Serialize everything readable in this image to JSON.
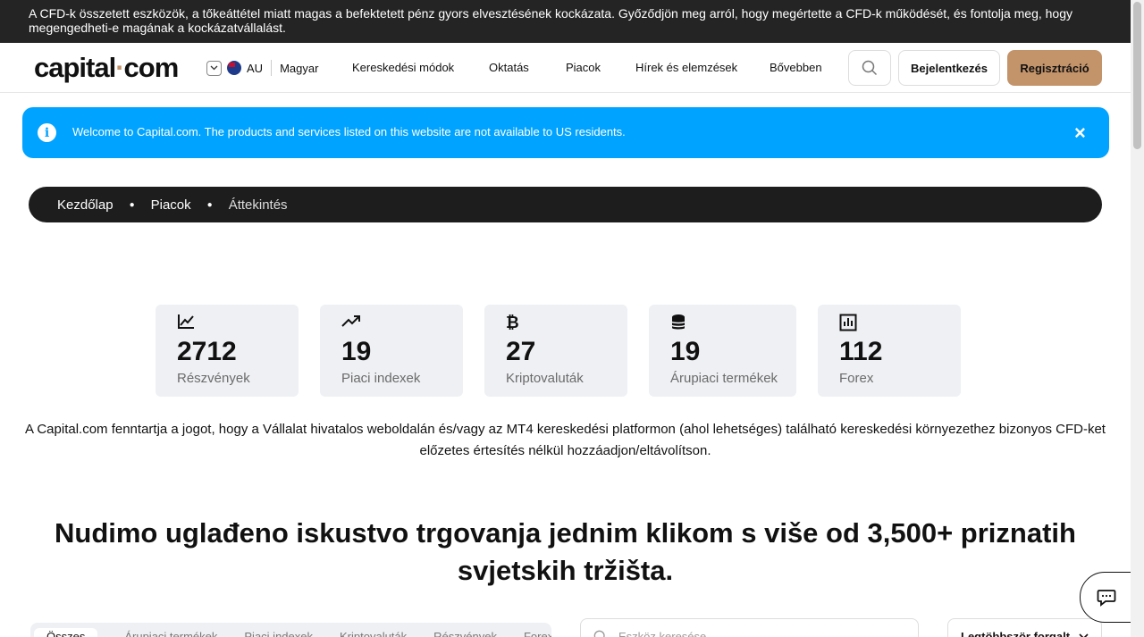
{
  "risk_warning": "A CFD-k összetett eszközök, a tőkeáttétel miatt magas a befektetett pénz gyors elvesztésének kockázata. Győződjön meg arról, hogy megértette a CFD-k működését, és fontolja meg, hogy megengedheti-e magának a kockázatvállalást.",
  "header": {
    "logo_main": "capital",
    "logo_dot": "·",
    "logo_tld": "com",
    "region": "AU",
    "language": "Magyar",
    "nav": [
      "Kereskedési módok",
      "Oktatás",
      "Piacok",
      "Hírek és elemzések",
      "Bővebben"
    ],
    "login_label": "Bejelentkezés",
    "register_label": "Regisztráció"
  },
  "notice": {
    "icon": "info-icon",
    "text": "Welcome to Capital.com. The products and services listed on this website are not available to US residents.",
    "close": "×"
  },
  "breadcrumb": [
    "Kezdőlap",
    "Piacok",
    "Áttekintés"
  ],
  "stats": [
    {
      "icon": "line-chart-icon",
      "value": "2712",
      "label": "Részvények"
    },
    {
      "icon": "trending-up-icon",
      "value": "19",
      "label": "Piaci indexek"
    },
    {
      "icon": "bitcoin-icon",
      "value": "27",
      "label": "Kriptovaluták"
    },
    {
      "icon": "database-icon",
      "value": "19",
      "label": "Árupiaci termékek"
    },
    {
      "icon": "bar-chart-icon",
      "value": "112",
      "label": "Forex"
    }
  ],
  "disclaimer": "A Capital.com fenntartja a jogot, hogy a Vállalat hivatalos weboldalán és/vagy az MT4 kereskedési platformon (ahol lehetséges) található kereskedési környezethez bizonyos CFD-ket előzetes értesítés nélkül hozzáadjon/eltávolítson.",
  "headline": "Nudimo uglađeno iskustvo trgovanja jednim klikom s više od 3,500+ priznatih svjetskih tržišta.",
  "filter_tabs": [
    "Összes",
    "Árupiaci termékek",
    "Piaci indexek",
    "Kriptovaluták",
    "Részvények",
    "Forex"
  ],
  "market_search_placeholder": "Eszköz keresése",
  "sort_label": "Legtöbbször forgalt"
}
